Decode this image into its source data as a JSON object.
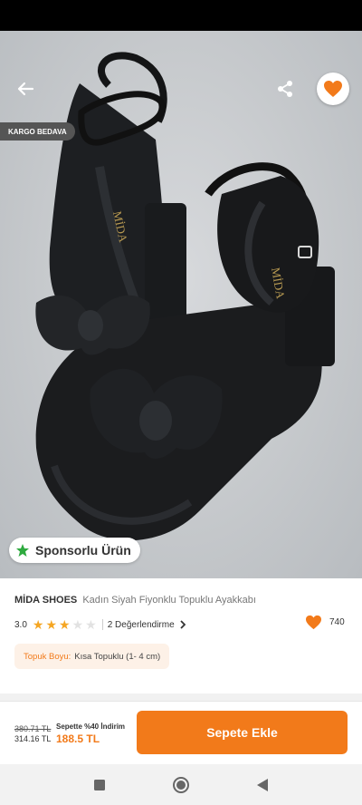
{
  "hero": {
    "cargo_badge": "KARGO BEDAVA",
    "sponsored_label": "Sponsorlu Ürün",
    "image_dots": 5,
    "active_dot": 0,
    "accent_color": "#f27a1a"
  },
  "product": {
    "brand": "MİDA SHOES",
    "name": "Kadın Siyah Fiyonklu Topuklu Ayakkabı",
    "rating": "3.0",
    "stars": 3,
    "reviews_label": "2 Değerlendirme",
    "likes": "740"
  },
  "attribute": {
    "key": "Topuk Boyu:",
    "value": "Kısa Topuklu (1- 4 cm)"
  },
  "buy_bar": {
    "old_price": "380.71 TL",
    "current_price": "314.16 TL",
    "discount_label": "Sepette %40 İndirim",
    "discounted_price": "188.5 TL",
    "add_to_cart": "Sepete Ekle"
  },
  "icons": {
    "back": "back-arrow-icon",
    "share": "share-icon",
    "favorite": "heart-icon",
    "sponsored": "star-icon",
    "chevron": "chevron-right-icon",
    "nav_recent": "square-icon",
    "nav_home": "circle-icon",
    "nav_back": "triangle-back-icon"
  }
}
